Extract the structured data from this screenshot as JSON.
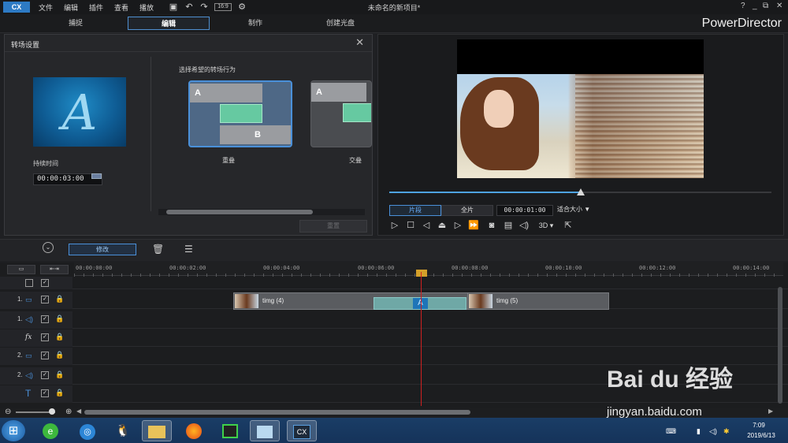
{
  "menu": [
    "文件",
    "编辑",
    "插件",
    "查看",
    "播放"
  ],
  "document_title": "未命名的新项目*",
  "window_controls": [
    "?",
    "_",
    "⧉",
    "✕"
  ],
  "modes": [
    {
      "label": "捕捉",
      "active": false
    },
    {
      "label": "编辑",
      "active": true
    },
    {
      "label": "制作",
      "active": false
    },
    {
      "label": "创建光盘",
      "active": false
    }
  ],
  "brand": "PowerDirector",
  "transition_panel": {
    "title": "转场设置",
    "duration_label": "持续时间",
    "duration_value": "00:00:03:00",
    "behavior_label": "选择希望的转场行为",
    "behaviors": [
      {
        "label": "重叠",
        "selected": true
      },
      {
        "label": "交叠",
        "selected": false
      }
    ],
    "card_a": "A",
    "card_b": "B",
    "reset_button": "重置"
  },
  "preview": {
    "clip_button": "片段",
    "movie_button": "全片",
    "timecode": "00:00:01:00",
    "fit_select": "适合大小",
    "three_d": "3D",
    "playback_progress": 0.5
  },
  "toolbar": {
    "modify_button": "修改"
  },
  "timeline": {
    "ruler": [
      "00:00:00:00",
      "00:00:02:00",
      "00:00:04:00",
      "00:00:06:00",
      "00:00:08:00",
      "00:00:10:00",
      "00:00:12:00",
      "00:00:14:00"
    ],
    "tracks": [
      {
        "num": "1.",
        "icon": "video-track-icon"
      },
      {
        "num": "1.",
        "icon": "audio-track-icon"
      },
      {
        "num": "",
        "icon": "fx-track-icon"
      },
      {
        "num": "2.",
        "icon": "video-track-icon"
      },
      {
        "num": "2.",
        "icon": "audio-track-icon"
      },
      {
        "num": "",
        "icon": "title-track-icon"
      }
    ],
    "clips": [
      {
        "label": "timg (4)"
      },
      {
        "label": "timg (5)"
      }
    ]
  },
  "taskbar": {
    "time": "7:09",
    "date": "2019/6/13"
  },
  "watermark": {
    "main": "Bai du 经验",
    "url": "jingyan.baidu.com"
  },
  "colors": {
    "accent": "#4a90d9",
    "transition": "#66c9a1",
    "playhead": "#d02020"
  }
}
